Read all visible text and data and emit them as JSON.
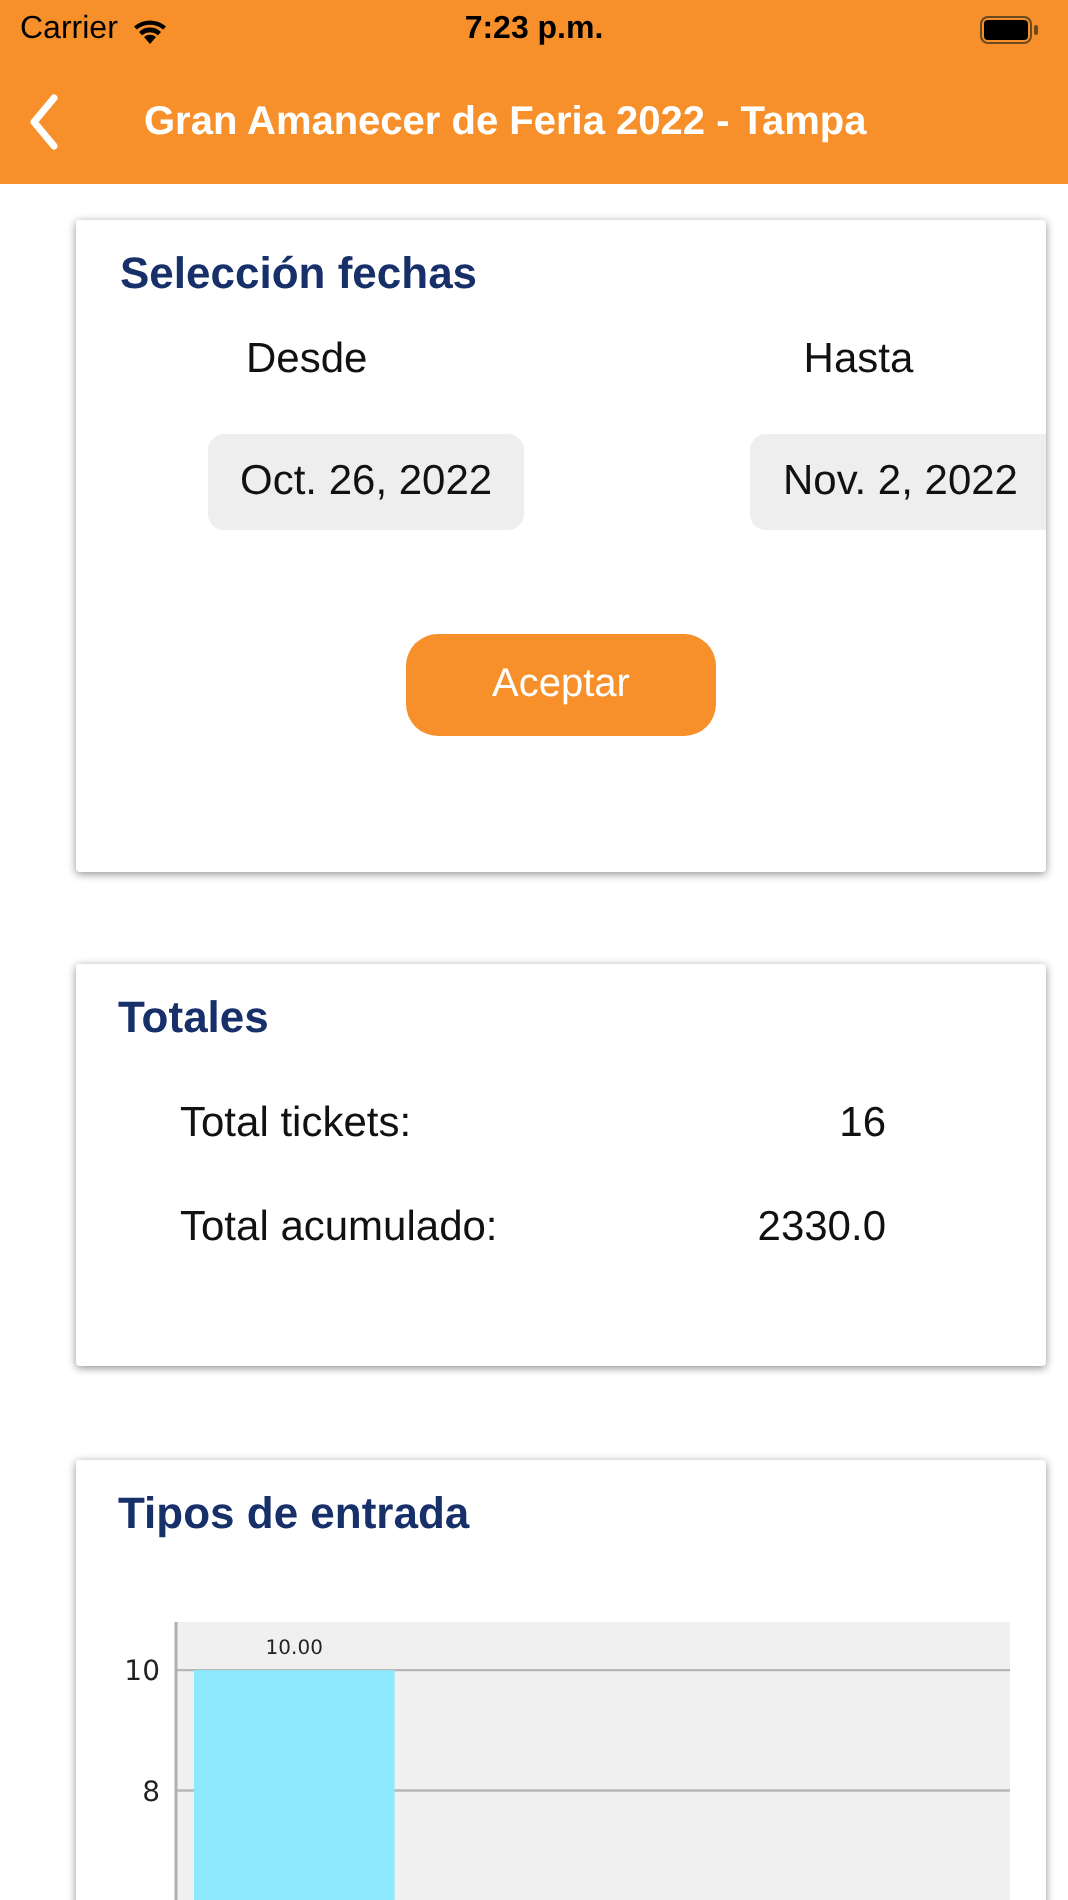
{
  "status_bar": {
    "carrier": "Carrier",
    "time": "7:23 p.m."
  },
  "nav_bar": {
    "title": "Gran Amanecer de Feria 2022 - Tampa"
  },
  "date_selection": {
    "title": "Selección fechas",
    "from_label": "Desde",
    "to_label": "Hasta",
    "from_value": "Oct. 26, 2022",
    "to_value": "Nov. 2, 2022",
    "button": "Aceptar"
  },
  "totals": {
    "title": "Totales",
    "rows": [
      {
        "label": "Total tickets:",
        "value": "16"
      },
      {
        "label": "Total acumulado:",
        "value": "2330.0"
      }
    ]
  },
  "ticket_types": {
    "title": "Tipos de entrada",
    "chart_data": {
      "type": "bar",
      "values": [
        10
      ],
      "ylim": [
        0,
        10.8
      ],
      "yticks": [
        8,
        10
      ],
      "value_labels": [
        "10.00"
      ]
    }
  }
}
